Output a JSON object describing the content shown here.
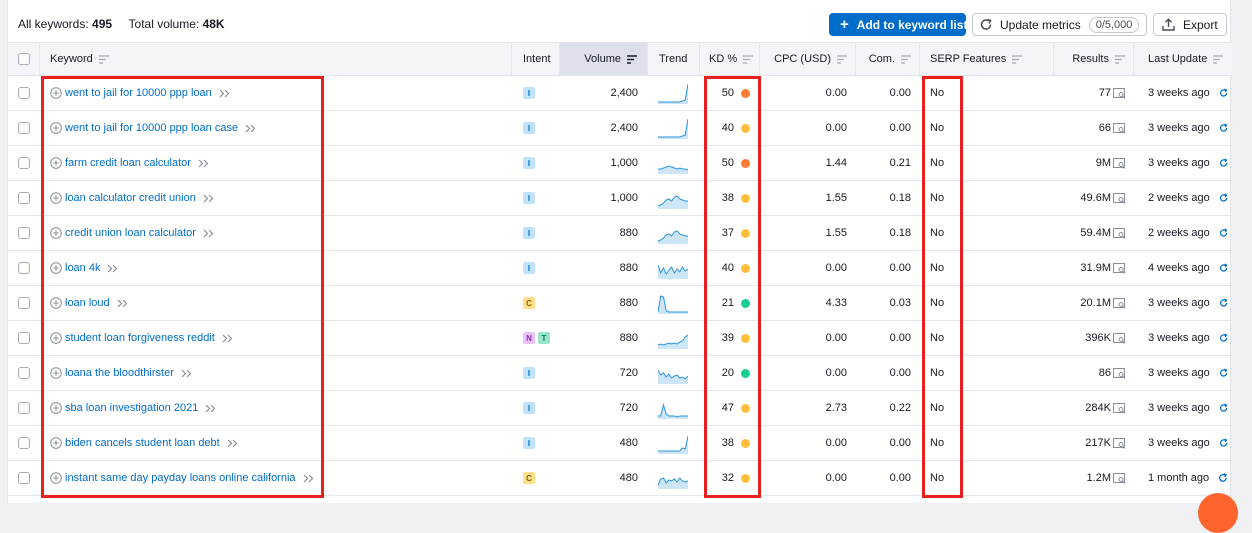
{
  "summary": {
    "all_keywords_label": "All keywords:",
    "all_keywords_value": "495",
    "total_volume_label": "Total volume:",
    "total_volume_value": "48K"
  },
  "toolbar": {
    "add_label": "Add to keyword list",
    "update_label": "Update metrics",
    "update_badge": "0/5,000",
    "export_label": "Export"
  },
  "columns": {
    "keyword": "Keyword",
    "intent": "Intent",
    "volume": "Volume",
    "trend": "Trend",
    "kd": "KD %",
    "cpc": "CPC (USD)",
    "com": "Com.",
    "serp": "SERP Features",
    "results": "Results",
    "last_update": "Last Update"
  },
  "colors": {
    "accent": "#006dca",
    "kd_orange": "#ff7a33",
    "kd_yellow": "#ffbf3d",
    "kd_green": "#17cf8d",
    "highlight": "#e8211c"
  },
  "rows": [
    {
      "keyword": "went to jail for 10000 ppp loan",
      "intent": [
        "I"
      ],
      "volume": "2,400",
      "trend": "spike",
      "kd": "50",
      "kd_color": "#ff7a33",
      "cpc": "0.00",
      "com": "0.00",
      "serp": "No",
      "results": "77",
      "last_update": "3 weeks ago"
    },
    {
      "keyword": "went to jail for 10000 ppp loan case",
      "intent": [
        "I"
      ],
      "volume": "2,400",
      "trend": "spike",
      "kd": "40",
      "kd_color": "#ffbf3d",
      "cpc": "0.00",
      "com": "0.00",
      "serp": "No",
      "results": "66",
      "last_update": "3 weeks ago"
    },
    {
      "keyword": "farm credit loan calculator",
      "intent": [
        "I"
      ],
      "volume": "1,000",
      "trend": "hump",
      "kd": "50",
      "kd_color": "#ff7a33",
      "cpc": "1.44",
      "com": "0.21",
      "serp": "No",
      "results": "9M",
      "last_update": "3 weeks ago"
    },
    {
      "keyword": "loan calculator credit union",
      "intent": [
        "I"
      ],
      "volume": "1,000",
      "trend": "rise",
      "kd": "38",
      "kd_color": "#ffbf3d",
      "cpc": "1.55",
      "com": "0.18",
      "serp": "No",
      "results": "49.6M",
      "last_update": "2 weeks ago"
    },
    {
      "keyword": "credit union loan calculator",
      "intent": [
        "I"
      ],
      "volume": "880",
      "trend": "rise",
      "kd": "37",
      "kd_color": "#ffbf3d",
      "cpc": "1.55",
      "com": "0.18",
      "serp": "No",
      "results": "59.4M",
      "last_update": "2 weeks ago"
    },
    {
      "keyword": "loan 4k",
      "intent": [
        "I"
      ],
      "volume": "880",
      "trend": "wave",
      "kd": "40",
      "kd_color": "#ffbf3d",
      "cpc": "0.00",
      "com": "0.00",
      "serp": "No",
      "results": "31.9M",
      "last_update": "4 weeks ago"
    },
    {
      "keyword": "loan loud",
      "intent": [
        "C"
      ],
      "volume": "880",
      "trend": "earlyspike",
      "kd": "21",
      "kd_color": "#17cf8d",
      "cpc": "4.33",
      "com": "0.03",
      "serp": "No",
      "results": "20.1M",
      "last_update": "3 weeks ago"
    },
    {
      "keyword": "student loan forgiveness reddit",
      "intent": [
        "N",
        "T"
      ],
      "volume": "880",
      "trend": "lateup",
      "kd": "39",
      "kd_color": "#ffbf3d",
      "cpc": "0.00",
      "com": "0.00",
      "serp": "No",
      "results": "396K",
      "last_update": "3 weeks ago"
    },
    {
      "keyword": "loana the bloodthirster",
      "intent": [
        "I"
      ],
      "volume": "720",
      "trend": "decay",
      "kd": "20",
      "kd_color": "#17cf8d",
      "cpc": "0.00",
      "com": "0.00",
      "serp": "No",
      "results": "86",
      "last_update": "3 weeks ago"
    },
    {
      "keyword": "sba loan investigation 2021",
      "intent": [
        "I"
      ],
      "volume": "720",
      "trend": "earlyspike2",
      "kd": "47",
      "kd_color": "#ffbf3d",
      "cpc": "2.73",
      "com": "0.22",
      "serp": "No",
      "results": "284K",
      "last_update": "3 weeks ago"
    },
    {
      "keyword": "biden cancels student loan debt",
      "intent": [
        "I"
      ],
      "volume": "480",
      "trend": "latespike",
      "kd": "38",
      "kd_color": "#ffbf3d",
      "cpc": "0.00",
      "com": "0.00",
      "serp": "No",
      "results": "217K",
      "last_update": "3 weeks ago"
    },
    {
      "keyword": "instant same day payday loans online california",
      "intent": [
        "C"
      ],
      "volume": "480",
      "trend": "bumpy",
      "kd": "32",
      "kd_color": "#ffbf3d",
      "cpc": "0.00",
      "com": "0.00",
      "serp": "No",
      "results": "1.2M",
      "last_update": "1 month ago"
    }
  ]
}
